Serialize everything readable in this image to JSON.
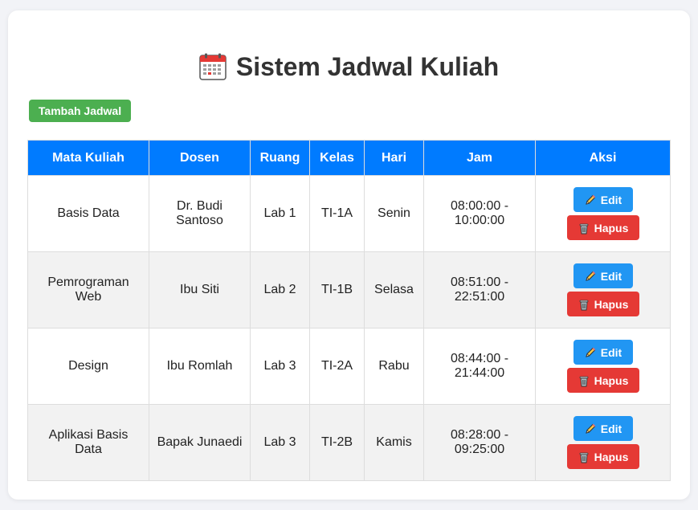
{
  "page": {
    "title": "Sistem Jadwal Kuliah",
    "title_icon": "calendar-icon",
    "add_button": "Tambah Jadwal"
  },
  "colors": {
    "header_bg": "#007bff",
    "add_button": "#4caf50",
    "edit_button": "#2196f3",
    "delete_button": "#e53935"
  },
  "table": {
    "columns": [
      "Mata Kuliah",
      "Dosen",
      "Ruang",
      "Kelas",
      "Hari",
      "Jam",
      "Aksi"
    ],
    "rows": [
      {
        "mata_kuliah": "Basis Data",
        "dosen": "Dr. Budi Santoso",
        "ruang": "Lab 1",
        "kelas": "TI-1A",
        "hari": "Senin",
        "jam": "08:00:00 - 10:00:00"
      },
      {
        "mata_kuliah": "Pemrograman Web",
        "dosen": "Ibu Siti",
        "ruang": "Lab 2",
        "kelas": "TI-1B",
        "hari": "Selasa",
        "jam": "08:51:00 - 22:51:00"
      },
      {
        "mata_kuliah": "Design",
        "dosen": "Ibu Romlah",
        "ruang": "Lab 3",
        "kelas": "TI-2A",
        "hari": "Rabu",
        "jam": "08:44:00 - 21:44:00"
      },
      {
        "mata_kuliah": "Aplikasi Basis Data",
        "dosen": "Bapak Junaedi",
        "ruang": "Lab 3",
        "kelas": "TI-2B",
        "hari": "Kamis",
        "jam": "08:28:00 - 09:25:00"
      }
    ],
    "edit_label": "Edit",
    "edit_icon": "pencil-icon",
    "delete_label": "Hapus",
    "delete_icon": "trash-icon"
  }
}
